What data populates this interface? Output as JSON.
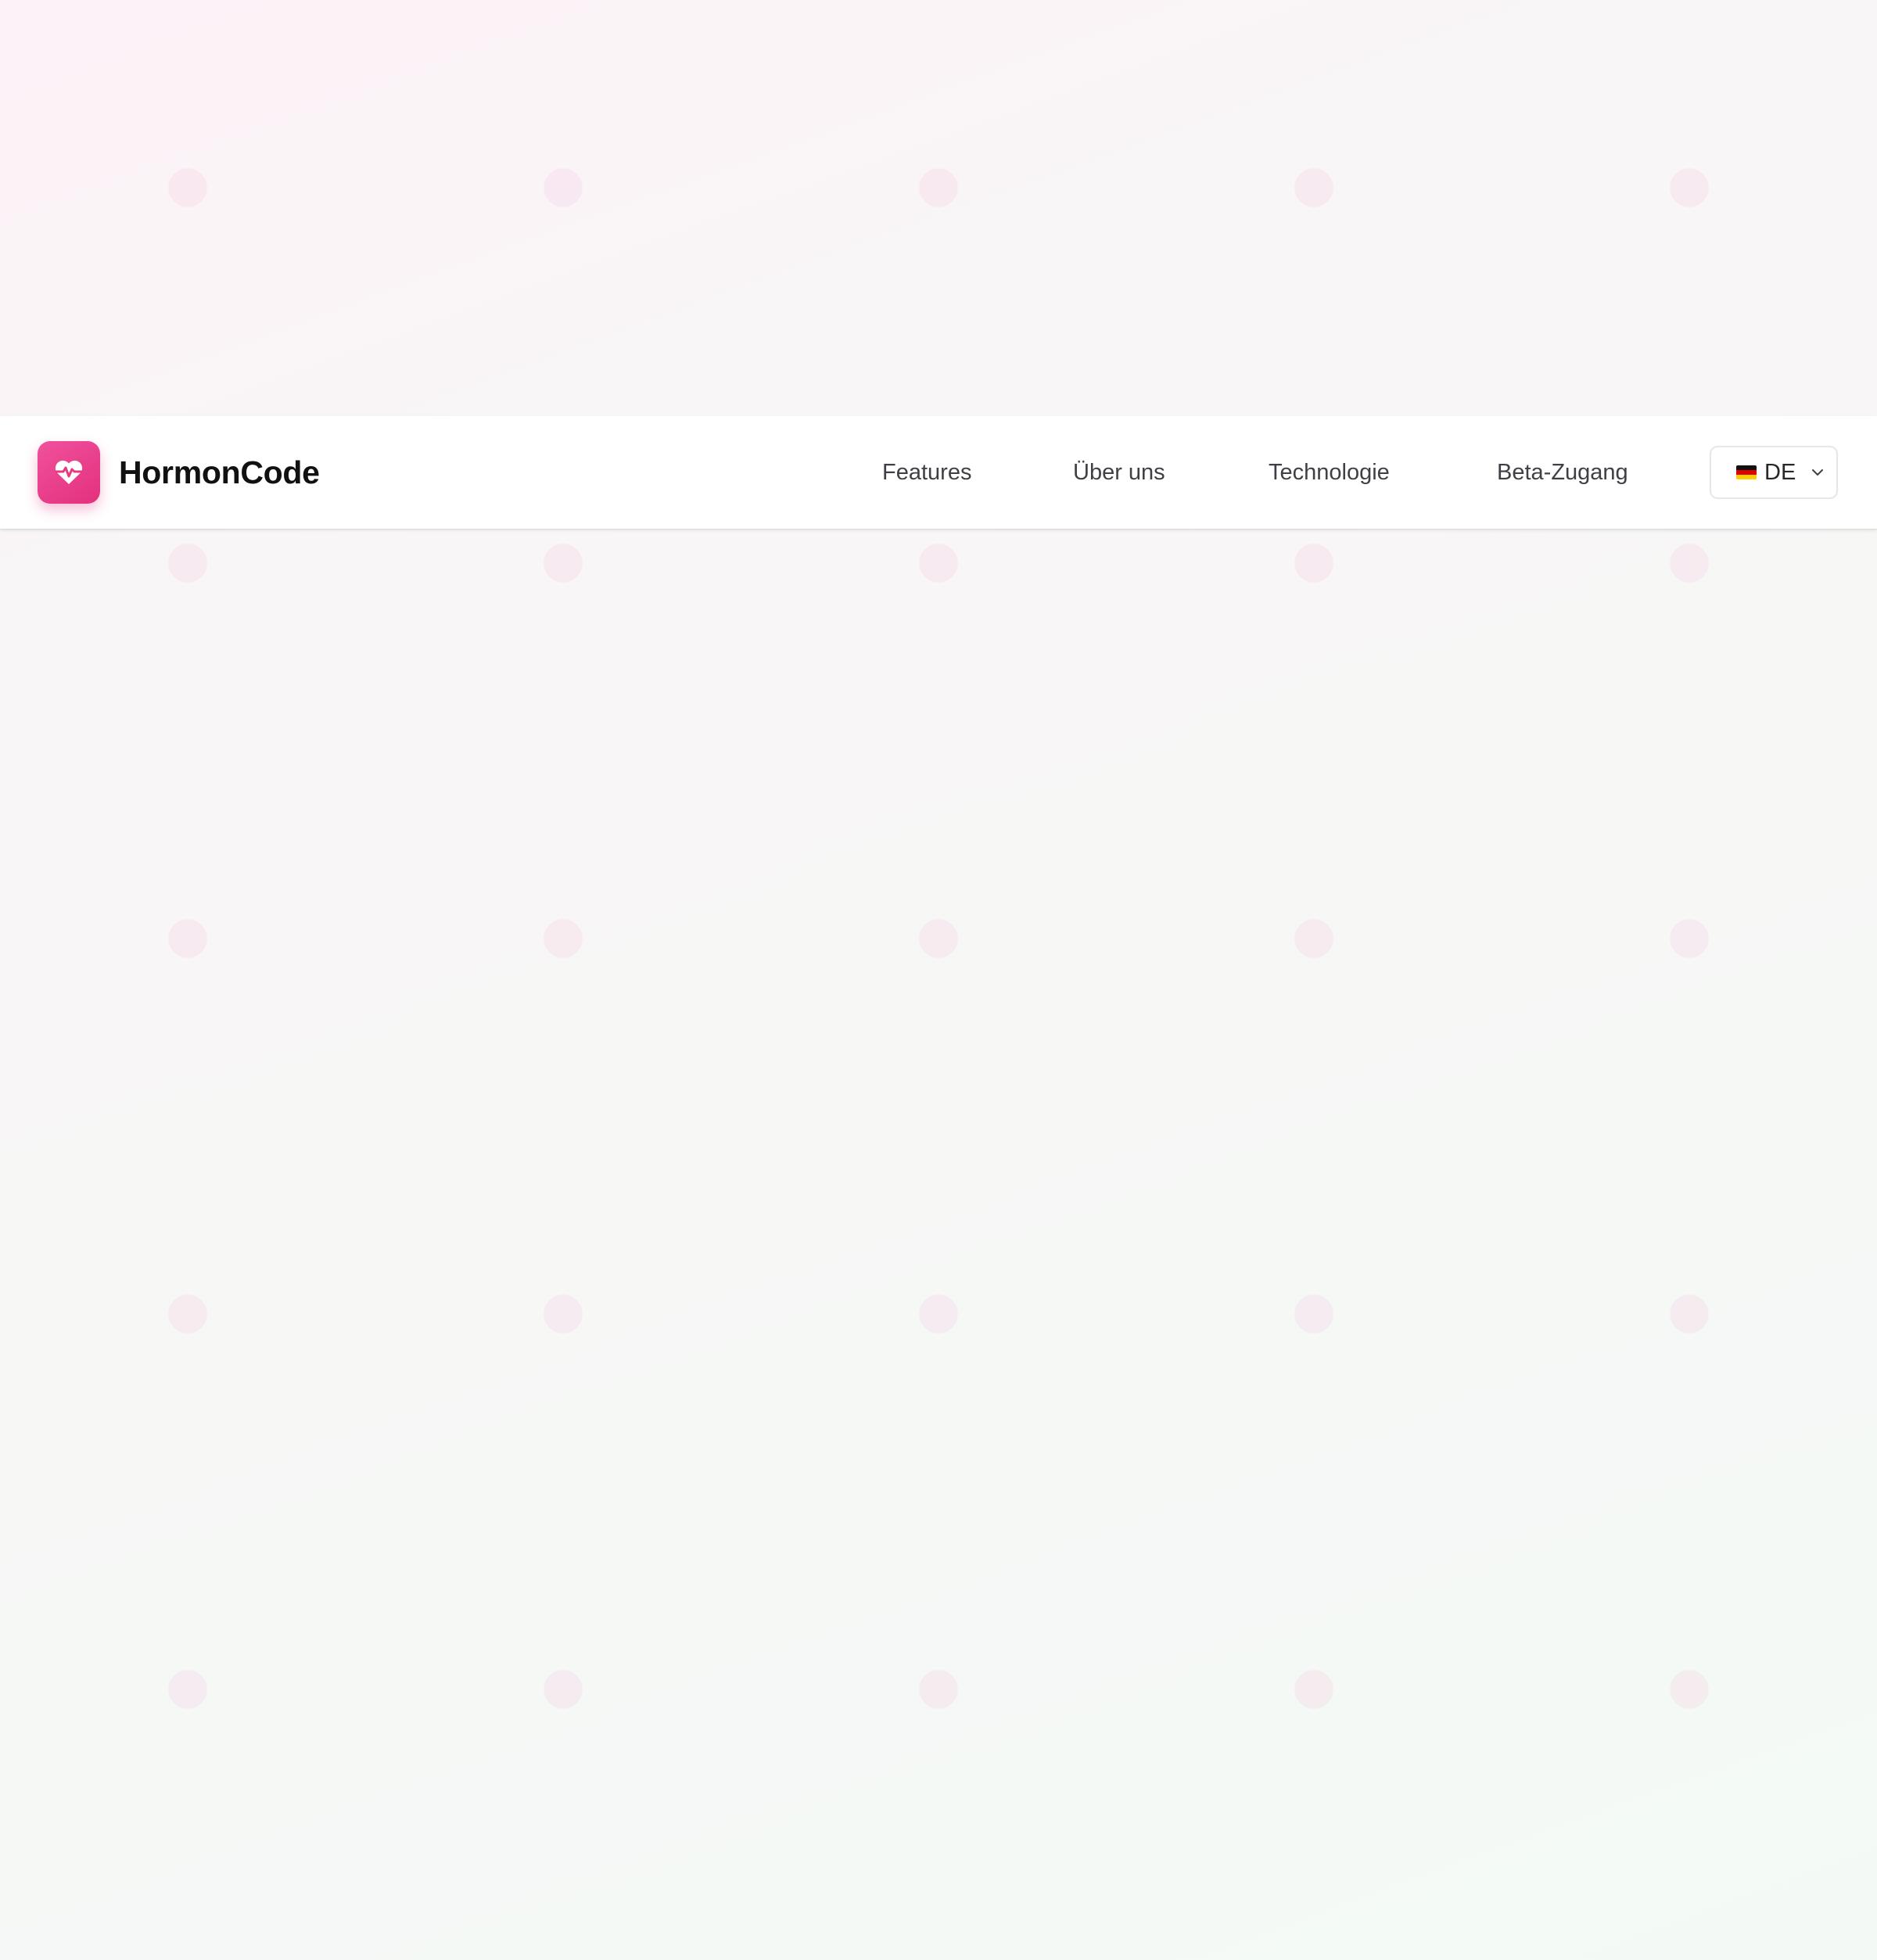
{
  "brand": {
    "name": "HormonCode",
    "logo_icon": "heart-pulse-icon",
    "accent_color": "#e9418b"
  },
  "nav": {
    "links": [
      {
        "label": "Features"
      },
      {
        "label": "Über uns"
      },
      {
        "label": "Technologie"
      },
      {
        "label": "Beta-Zugang"
      }
    ]
  },
  "language": {
    "flag_icon": "german-flag-icon",
    "selected": "DE",
    "dropdown_icon": "chevron-down-icon"
  }
}
